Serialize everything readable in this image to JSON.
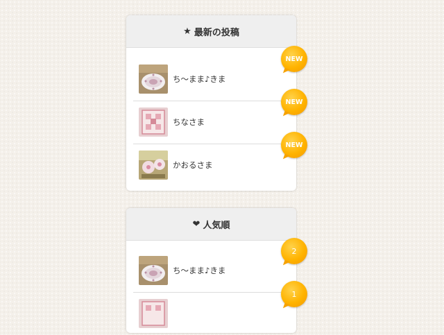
{
  "new_posts": {
    "title": "最新の投稿",
    "icon": "star-icon",
    "icon_glyph": "★",
    "badge_label": "NEW",
    "items": [
      {
        "label": "ち〜まま♪きま"
      },
      {
        "label": "ちなさま"
      },
      {
        "label": "かおるさま"
      }
    ]
  },
  "popular": {
    "title": "人気順",
    "icon": "heart-icon",
    "icon_glyph": "❤",
    "items": [
      {
        "label": "ち〜まま♪きま",
        "rank": "2"
      },
      {
        "label": "",
        "rank": "1"
      }
    ]
  },
  "colors": {
    "badge": "#ffb300",
    "header_bg": "#efefef",
    "page_bg": "#f4f0ea"
  }
}
